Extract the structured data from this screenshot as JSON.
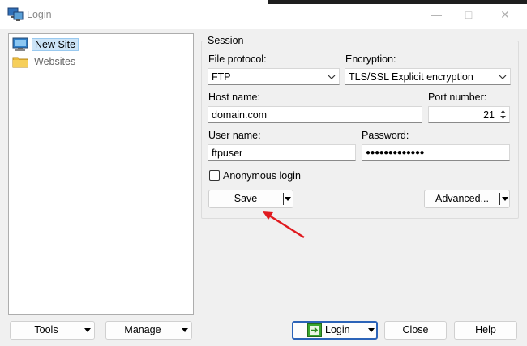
{
  "window": {
    "title": "Login"
  },
  "tree": {
    "items": [
      {
        "label": "New Site",
        "icon": "computer-icon"
      },
      {
        "label": "Websites",
        "icon": "folder-icon"
      }
    ]
  },
  "session": {
    "group_title": "Session",
    "file_protocol": {
      "label": "File protocol:",
      "value": "FTP"
    },
    "encryption": {
      "label": "Encryption:",
      "value": "TLS/SSL Explicit encryption"
    },
    "host": {
      "label": "Host name:",
      "value": "domain.com"
    },
    "port": {
      "label": "Port number:",
      "value": "21"
    },
    "user": {
      "label": "User name:",
      "value": "ftpuser"
    },
    "password": {
      "label": "Password:",
      "value": "●●●●●●●●●●●●●"
    },
    "anonymous_label": "Anonymous login",
    "save_label": "Save",
    "advanced_label": "Advanced..."
  },
  "bottom": {
    "tools_label": "Tools",
    "manage_label": "Manage",
    "login_label": "Login",
    "close_label": "Close",
    "help_label": "Help"
  },
  "colors": {
    "selection": "#cce4f7",
    "arrow": "#e0191e",
    "login_border": "#2b63b8",
    "login_icon": "#3aa52e"
  }
}
